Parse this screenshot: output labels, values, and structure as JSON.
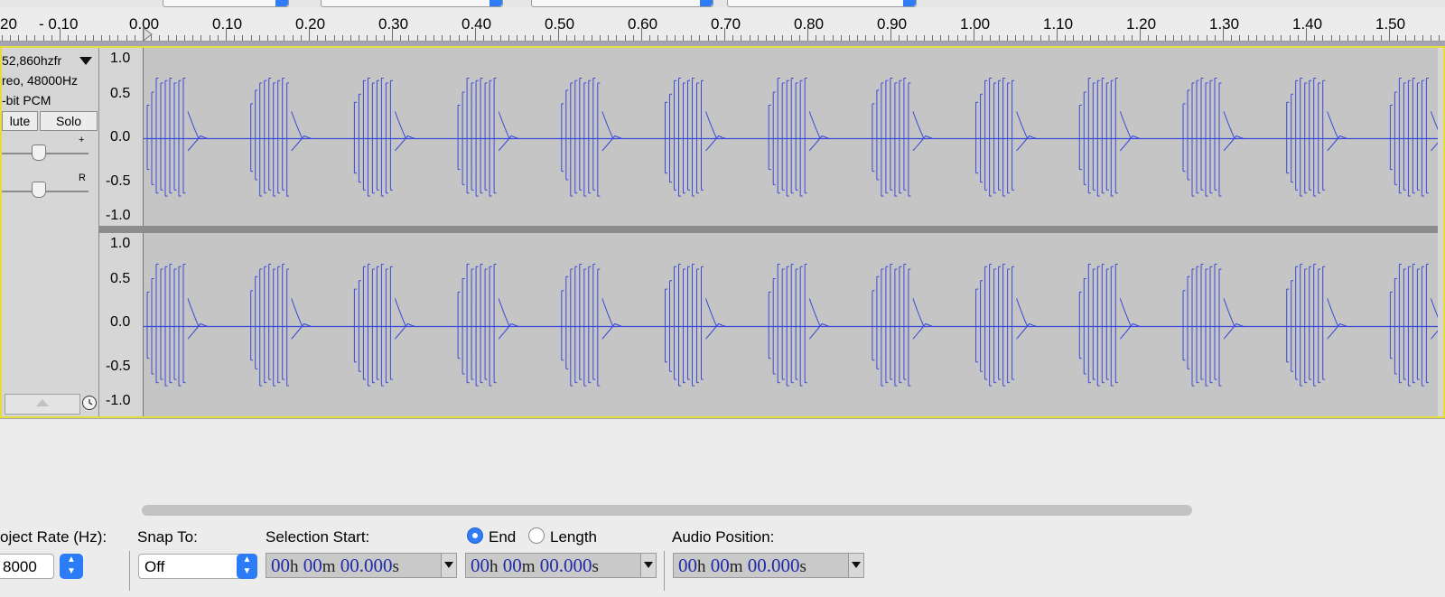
{
  "ruler": {
    "ticks": [
      "20",
      "- 0.10",
      "0.00",
      "0.10",
      "0.20",
      "0.30",
      "0.40",
      "0.50",
      "0.60",
      "0.70",
      "0.80",
      "0.90",
      "1.00",
      "1.10",
      "1.20",
      "1.30",
      "1.40",
      "1.50"
    ]
  },
  "track": {
    "name": "52,860hzfr",
    "info_format": "reo, 48000Hz",
    "info_bits": "-bit PCM",
    "mute_label": "lute",
    "solo_label": "Solo",
    "gain_tag": "+",
    "pan_tag": "R",
    "scale_labels": [
      "1.0",
      "0.5",
      "0.0",
      "-0.5",
      "-1.0"
    ],
    "waveform_color": "#3a4bd6"
  },
  "bottom": {
    "project_rate_label": "oject Rate (Hz):",
    "project_rate_value": "8000",
    "snap_to_label": "Snap To:",
    "snap_to_value": "Off",
    "selection_start_label": "Selection Start:",
    "end_label": "End",
    "length_label": "Length",
    "audio_position_label": "Audio Position:",
    "time_hours": "00",
    "time_h": "h",
    "time_minutes": "00",
    "time_m": "m",
    "time_seconds": "00.000",
    "time_s": "s"
  },
  "colors": {
    "accent": "#2f7cf6",
    "track_border": "#e4dd3b",
    "empty_area": "#a5a4b4"
  }
}
